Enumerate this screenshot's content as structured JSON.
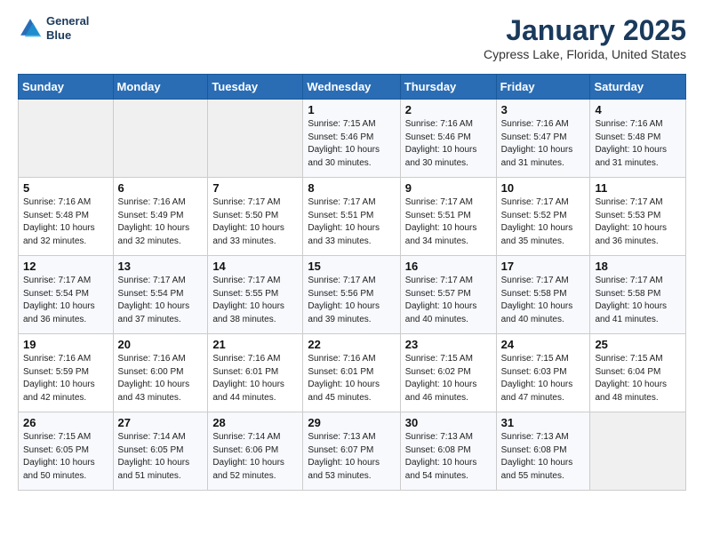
{
  "header": {
    "logo_line1": "General",
    "logo_line2": "Blue",
    "month": "January 2025",
    "location": "Cypress Lake, Florida, United States"
  },
  "weekdays": [
    "Sunday",
    "Monday",
    "Tuesday",
    "Wednesday",
    "Thursday",
    "Friday",
    "Saturday"
  ],
  "weeks": [
    [
      {
        "day": "",
        "info": ""
      },
      {
        "day": "",
        "info": ""
      },
      {
        "day": "",
        "info": ""
      },
      {
        "day": "1",
        "info": "Sunrise: 7:15 AM\nSunset: 5:46 PM\nDaylight: 10 hours\nand 30 minutes."
      },
      {
        "day": "2",
        "info": "Sunrise: 7:16 AM\nSunset: 5:46 PM\nDaylight: 10 hours\nand 30 minutes."
      },
      {
        "day": "3",
        "info": "Sunrise: 7:16 AM\nSunset: 5:47 PM\nDaylight: 10 hours\nand 31 minutes."
      },
      {
        "day": "4",
        "info": "Sunrise: 7:16 AM\nSunset: 5:48 PM\nDaylight: 10 hours\nand 31 minutes."
      }
    ],
    [
      {
        "day": "5",
        "info": "Sunrise: 7:16 AM\nSunset: 5:48 PM\nDaylight: 10 hours\nand 32 minutes."
      },
      {
        "day": "6",
        "info": "Sunrise: 7:16 AM\nSunset: 5:49 PM\nDaylight: 10 hours\nand 32 minutes."
      },
      {
        "day": "7",
        "info": "Sunrise: 7:17 AM\nSunset: 5:50 PM\nDaylight: 10 hours\nand 33 minutes."
      },
      {
        "day": "8",
        "info": "Sunrise: 7:17 AM\nSunset: 5:51 PM\nDaylight: 10 hours\nand 33 minutes."
      },
      {
        "day": "9",
        "info": "Sunrise: 7:17 AM\nSunset: 5:51 PM\nDaylight: 10 hours\nand 34 minutes."
      },
      {
        "day": "10",
        "info": "Sunrise: 7:17 AM\nSunset: 5:52 PM\nDaylight: 10 hours\nand 35 minutes."
      },
      {
        "day": "11",
        "info": "Sunrise: 7:17 AM\nSunset: 5:53 PM\nDaylight: 10 hours\nand 36 minutes."
      }
    ],
    [
      {
        "day": "12",
        "info": "Sunrise: 7:17 AM\nSunset: 5:54 PM\nDaylight: 10 hours\nand 36 minutes."
      },
      {
        "day": "13",
        "info": "Sunrise: 7:17 AM\nSunset: 5:54 PM\nDaylight: 10 hours\nand 37 minutes."
      },
      {
        "day": "14",
        "info": "Sunrise: 7:17 AM\nSunset: 5:55 PM\nDaylight: 10 hours\nand 38 minutes."
      },
      {
        "day": "15",
        "info": "Sunrise: 7:17 AM\nSunset: 5:56 PM\nDaylight: 10 hours\nand 39 minutes."
      },
      {
        "day": "16",
        "info": "Sunrise: 7:17 AM\nSunset: 5:57 PM\nDaylight: 10 hours\nand 40 minutes."
      },
      {
        "day": "17",
        "info": "Sunrise: 7:17 AM\nSunset: 5:58 PM\nDaylight: 10 hours\nand 40 minutes."
      },
      {
        "day": "18",
        "info": "Sunrise: 7:17 AM\nSunset: 5:58 PM\nDaylight: 10 hours\nand 41 minutes."
      }
    ],
    [
      {
        "day": "19",
        "info": "Sunrise: 7:16 AM\nSunset: 5:59 PM\nDaylight: 10 hours\nand 42 minutes."
      },
      {
        "day": "20",
        "info": "Sunrise: 7:16 AM\nSunset: 6:00 PM\nDaylight: 10 hours\nand 43 minutes."
      },
      {
        "day": "21",
        "info": "Sunrise: 7:16 AM\nSunset: 6:01 PM\nDaylight: 10 hours\nand 44 minutes."
      },
      {
        "day": "22",
        "info": "Sunrise: 7:16 AM\nSunset: 6:01 PM\nDaylight: 10 hours\nand 45 minutes."
      },
      {
        "day": "23",
        "info": "Sunrise: 7:15 AM\nSunset: 6:02 PM\nDaylight: 10 hours\nand 46 minutes."
      },
      {
        "day": "24",
        "info": "Sunrise: 7:15 AM\nSunset: 6:03 PM\nDaylight: 10 hours\nand 47 minutes."
      },
      {
        "day": "25",
        "info": "Sunrise: 7:15 AM\nSunset: 6:04 PM\nDaylight: 10 hours\nand 48 minutes."
      }
    ],
    [
      {
        "day": "26",
        "info": "Sunrise: 7:15 AM\nSunset: 6:05 PM\nDaylight: 10 hours\nand 50 minutes."
      },
      {
        "day": "27",
        "info": "Sunrise: 7:14 AM\nSunset: 6:05 PM\nDaylight: 10 hours\nand 51 minutes."
      },
      {
        "day": "28",
        "info": "Sunrise: 7:14 AM\nSunset: 6:06 PM\nDaylight: 10 hours\nand 52 minutes."
      },
      {
        "day": "29",
        "info": "Sunrise: 7:13 AM\nSunset: 6:07 PM\nDaylight: 10 hours\nand 53 minutes."
      },
      {
        "day": "30",
        "info": "Sunrise: 7:13 AM\nSunset: 6:08 PM\nDaylight: 10 hours\nand 54 minutes."
      },
      {
        "day": "31",
        "info": "Sunrise: 7:13 AM\nSunset: 6:08 PM\nDaylight: 10 hours\nand 55 minutes."
      },
      {
        "day": "",
        "info": ""
      }
    ]
  ]
}
